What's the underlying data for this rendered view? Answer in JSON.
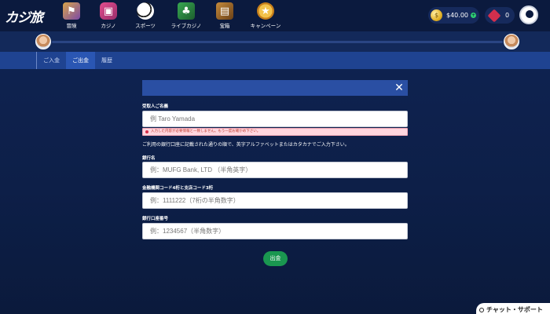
{
  "logo": "カジ旅",
  "nav": [
    {
      "label": "冒険"
    },
    {
      "label": "カジノ"
    },
    {
      "label": "スポーツ"
    },
    {
      "label": "ライブカジノ"
    },
    {
      "label": "宝箱"
    },
    {
      "label": "キャンペーン"
    }
  ],
  "balance": {
    "amount": "$40.00",
    "plus": "+"
  },
  "gems": {
    "count": "0"
  },
  "progress": {
    "value": 0
  },
  "tabs": [
    {
      "label": "ご入金"
    },
    {
      "label": "ご出金"
    },
    {
      "label": "履歴"
    }
  ],
  "form": {
    "recipient_label": "受取人ご名義",
    "recipient_placeholder": "例  Taro Yamada",
    "error_message": "入力した内容が必要情報と一致しません。もう一度お確かめ下さい。",
    "notice": "ご利用の銀行口座に記載された通りの順で、英字アルファベットまたはカタカナでご入力下さい。",
    "bank_label": "銀行名",
    "bank_placeholder": "例：MUFG Bank, LTD （半角英字）",
    "code_label": "金融機関コード4桁と支店コード3桁",
    "code_placeholder": "例：1111222（7桁の半角数字）",
    "account_label": "銀行口座番号",
    "account_placeholder": "例：1234567（半角数字）",
    "submit_label": "出金",
    "close": "✕"
  },
  "chat": {
    "label": "チャット・サポート"
  },
  "colors": {
    "background": "#0f2454",
    "tab_bar": "#1f4391",
    "submit": "#1a9750",
    "error": "#ffd6df"
  }
}
